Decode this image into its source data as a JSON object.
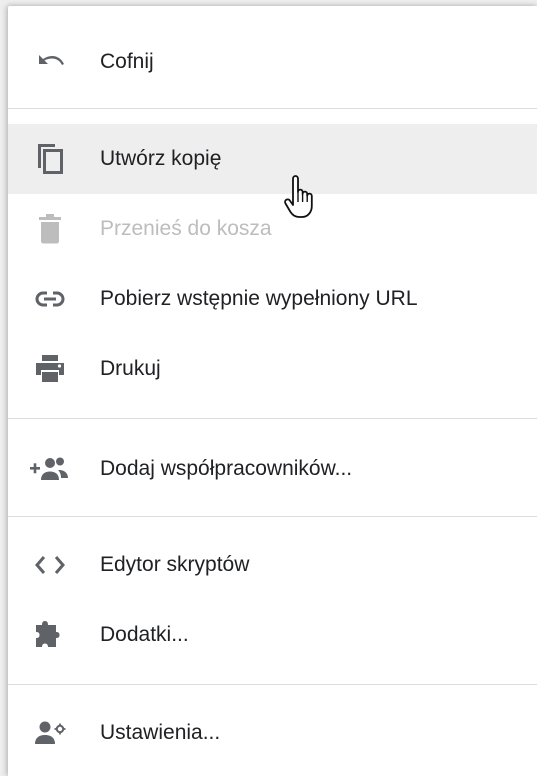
{
  "menu": {
    "items": [
      {
        "id": "undo",
        "label": "Cofnij",
        "icon": "undo-icon",
        "enabled": true
      },
      {
        "id": "copy",
        "label": "Utwórz kopię",
        "icon": "copy-icon",
        "enabled": true,
        "hovered": true
      },
      {
        "id": "trash",
        "label": "Przenieś do kosza",
        "icon": "trash-icon",
        "enabled": false
      },
      {
        "id": "prefilled-url",
        "label": "Pobierz wstępnie wypełniony URL",
        "icon": "link-icon",
        "enabled": true
      },
      {
        "id": "print",
        "label": "Drukuj",
        "icon": "print-icon",
        "enabled": true
      },
      {
        "id": "collaborators",
        "label": "Dodaj współpracowników...",
        "icon": "add-people-icon",
        "enabled": true
      },
      {
        "id": "script-editor",
        "label": "Edytor skryptów",
        "icon": "code-icon",
        "enabled": true
      },
      {
        "id": "addons",
        "label": "Dodatki...",
        "icon": "puzzle-icon",
        "enabled": true
      },
      {
        "id": "settings",
        "label": "Ustawienia...",
        "icon": "person-settings-icon",
        "enabled": true
      }
    ]
  },
  "colors": {
    "text": "#202124",
    "disabled_text": "#bdbdbd",
    "icon": "#5f6368",
    "disabled_icon": "#bdbdbd",
    "hover_background": "#eeeeee",
    "divider": "#dadce0"
  },
  "cursor": {
    "icon": "hand-pointer-icon"
  }
}
